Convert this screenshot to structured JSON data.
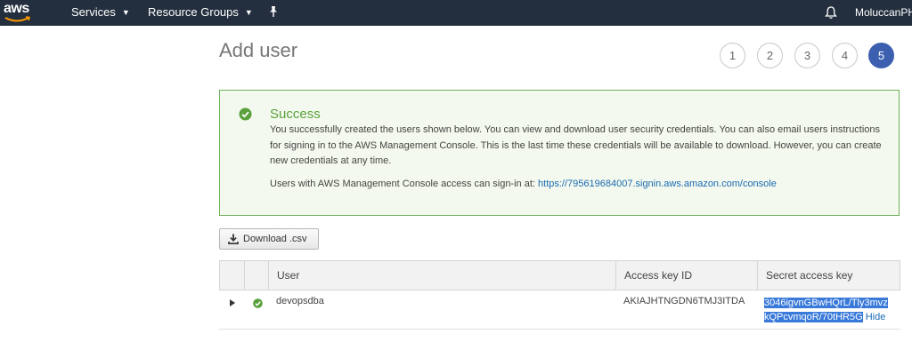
{
  "nav": {
    "logo": "aws",
    "services": "Services",
    "resource_groups": "Resource Groups",
    "account": "MoluccanPHH"
  },
  "page": {
    "title": "Add user",
    "steps": [
      "1",
      "2",
      "3",
      "4",
      "5"
    ],
    "active_step": "5"
  },
  "success": {
    "heading": "Success",
    "message": "You successfully created the users shown below. You can view and download user security credentials. You can also email users instructions for signing in to the AWS Management Console. This is the last time these credentials will be available to download. However, you can create new credentials at any time.",
    "signin_prefix": "Users with AWS Management Console access can sign-in at: ",
    "signin_url": "https://795619684007.signin.aws.amazon.com/console"
  },
  "download_button": "Download .csv",
  "table": {
    "columns": [
      "User",
      "Access key ID",
      "Secret access key"
    ],
    "rows": [
      {
        "user": "devopsdba",
        "access_key_id": "AKIAJHTNGDN6TMJ3ITDA",
        "secret_line1": "3046igvnGBwHQrL/Tly3mvz",
        "secret_line2": "kQPcvmqoR/70tHR5G",
        "hide_label": "Hide"
      }
    ]
  },
  "colors": {
    "nav_bg": "#232f3e",
    "success_border": "#6fb15d",
    "success_bg": "#f3f9ee",
    "success_text": "#5aa13b",
    "active_step": "#3d5fb0",
    "link": "#1a6ab2",
    "selection": "#3879d9"
  },
  "icons": {
    "pin": "pin-icon",
    "bell": "bell-icon",
    "success": "check-circle-icon",
    "download": "download-icon",
    "expand": "caret-right-icon"
  }
}
